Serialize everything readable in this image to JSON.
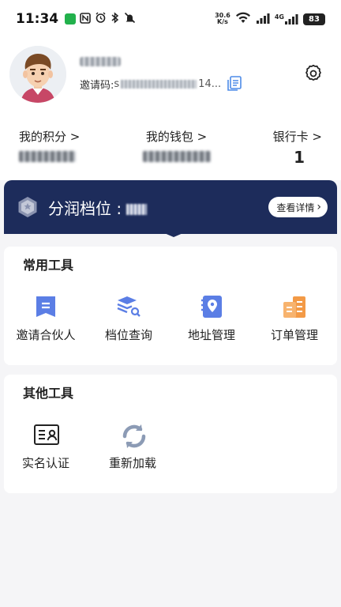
{
  "status_bar": {
    "time": "11:34",
    "speed_value": "30.6",
    "speed_unit": "K/s",
    "network_label": "4G",
    "battery": "83"
  },
  "profile": {
    "invite_label": "邀请码:",
    "invite_code_tail": "s",
    "invite_code_end": "14..."
  },
  "stats": [
    {
      "label": "我的积分 >"
    },
    {
      "label": "我的钱包 >"
    },
    {
      "label": "银行卡 >",
      "value": "1"
    }
  ],
  "tier": {
    "title": "分润档位 :",
    "details_button": "查看详情",
    "details_chevron": "›"
  },
  "common_tools": {
    "title": "常用工具",
    "items": [
      {
        "label": "邀请合伙人",
        "icon": "invite-partner-icon"
      },
      {
        "label": "档位查询",
        "icon": "tier-query-icon"
      },
      {
        "label": "地址管理",
        "icon": "address-manage-icon"
      },
      {
        "label": "订单管理",
        "icon": "order-manage-icon"
      }
    ]
  },
  "other_tools": {
    "title": "其他工具",
    "items": [
      {
        "label": "实名认证",
        "icon": "id-card-icon"
      },
      {
        "label": "重新加载",
        "icon": "reload-icon"
      }
    ]
  },
  "colors": {
    "banner": "#1d2c5b",
    "accent_blue": "#5b7ee5",
    "accent_orange": "#f39a46",
    "background": "#f5f5f7"
  }
}
